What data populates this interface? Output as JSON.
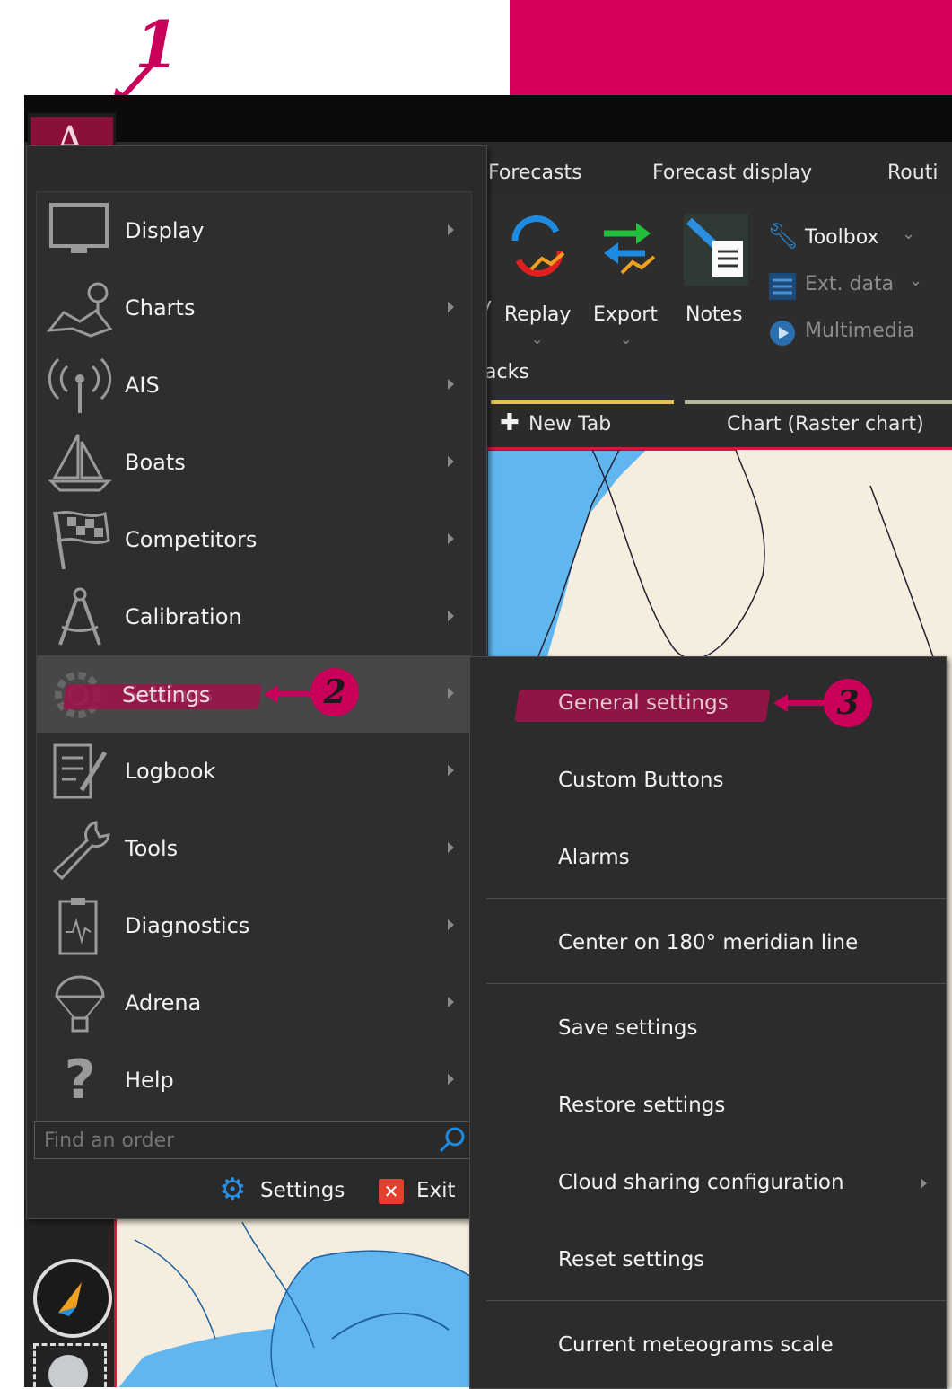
{
  "annotations": {
    "step1": "1",
    "step2": "2",
    "step3": "3",
    "colors": {
      "accent": "#d6005a",
      "highlight": "#a0124a"
    }
  },
  "app": {
    "tabs": [
      "Forecasts",
      "Forecast display",
      "Routi"
    ],
    "ribbon": {
      "partial_label": "y",
      "replay_label": "Replay",
      "export_label": "Export",
      "notes_label": "Notes",
      "toolbox_label": "Toolbox",
      "ext_data_label": "Ext. data",
      "multimedia_label": "Multimedia",
      "group_label": "acks"
    },
    "chart_tabs": {
      "new_tab_label": "New Tab",
      "chart_label": "Chart (Raster chart)"
    }
  },
  "main_menu": {
    "items": [
      {
        "label": "Display",
        "icon": "monitor-icon"
      },
      {
        "label": "Charts",
        "icon": "map-pin-icon"
      },
      {
        "label": "AIS",
        "icon": "antenna-icon"
      },
      {
        "label": "Boats",
        "icon": "sailboat-icon"
      },
      {
        "label": "Competitors",
        "icon": "checkered-flag-icon"
      },
      {
        "label": "Calibration",
        "icon": "compass-tool-icon"
      },
      {
        "label": "Settings",
        "icon": "gear-icon"
      },
      {
        "label": "Logbook",
        "icon": "notebook-icon"
      },
      {
        "label": "Tools",
        "icon": "wrench-icon"
      },
      {
        "label": "Diagnostics",
        "icon": "clipboard-chart-icon"
      },
      {
        "label": "Adrena",
        "icon": "parachute-icon"
      },
      {
        "label": "Help",
        "icon": "question-icon"
      }
    ],
    "search_placeholder": "Find an order",
    "footer": {
      "settings_label": "Settings",
      "exit_label": "Exit"
    }
  },
  "submenu": {
    "items": [
      {
        "label": "General settings"
      },
      {
        "label": "Custom Buttons"
      },
      {
        "label": "Alarms"
      },
      {
        "label": "Center on 180° meridian line"
      },
      {
        "label": "Save settings"
      },
      {
        "label": "Restore settings"
      },
      {
        "label": "Cloud sharing configuration"
      },
      {
        "label": "Reset settings"
      },
      {
        "label": "Current meteograms scale"
      }
    ]
  }
}
